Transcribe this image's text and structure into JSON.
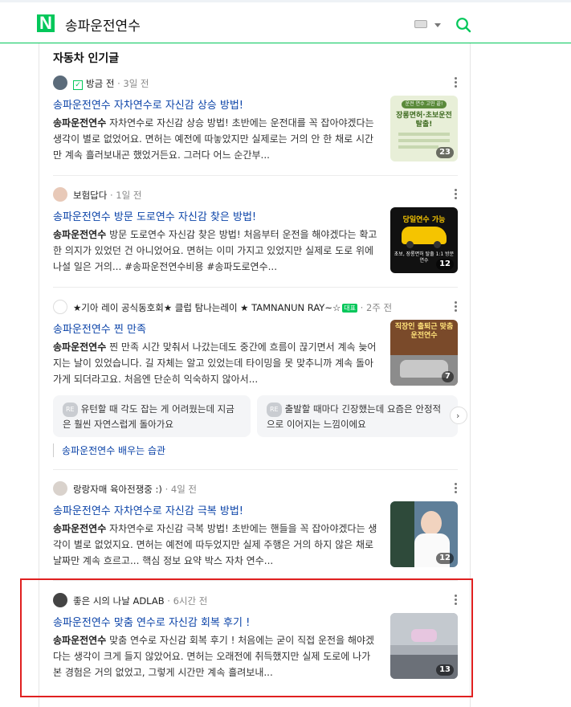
{
  "header": {
    "title": "송파운전연수",
    "logo_letter": "N"
  },
  "section": {
    "title": "자동차 인기글"
  },
  "posts": [
    {
      "author": "방금 전",
      "time": "· 3일 전",
      "title": "송파운전연수 자차연수로 자신감 상승 방법!",
      "body_bold": "송파운전연수",
      "body": " 자차연수로 자신감 상승 방법! 초반에는 운전대를 꼭 잡아야겠다는 생각이 별로 없었어요. 면허는 예전에 따놓았지만 실제로는 거의 안 한 채로 시간만 계속 흘러보내곤 했었거든요. 그러다 어느 순간부...",
      "thumb_count": "23"
    },
    {
      "author": "보험답다",
      "time": "· 1일 전",
      "title": "송파운전연수 방문 도로연수 자신감 찾은 방법!",
      "body_bold": "송파운전연수",
      "body": " 방문 도로연수 자신감 찾은 방법! 처음부터 운전을 해야겠다는 확고한 의지가 있었던 건 아니었어요. 면허는 이미 가지고 있었지만 실제로 도로 위에 나설 일은 거의... #송파운전연수비용 #송파도로연수...",
      "thumb_count": "12"
    },
    {
      "author": "★기아 레이 공식동호회★ 클럽 탐나는레이 ★ TAMNANUN RAY~☆",
      "badge": "대표",
      "time": "· 2주 전",
      "title": "송파운전연수 찐 만족",
      "body_bold": "송파운전연수",
      "body": " 찐 만족 시간 맞춰서 나갔는데도 중간에 흐름이 끊기면서 계속 늦어지는 날이 있었습니다. 길 자체는 알고 있었는데 타이밍을 못 맞추니까 계속 돌아가게 되더라고요. 처음엔 단순히 익숙하지 않아서...",
      "thumb_count": "7",
      "replies": [
        "유턴할 때 각도 잡는 게 어려웠는데 지금은 훨씬 자연스럽게 돌아가요",
        "출발할 때마다 긴장했는데 요즘은 안정적으로 이어지는 느낌이에요"
      ],
      "re_label": "RE",
      "tag": "송파운전연수 배우는 습관"
    },
    {
      "author": "랑랑자매 육아전쟁중 :)",
      "time": "· 4일 전",
      "title": "송파운전연수 자차연수로 자신감 극복 방법!",
      "body_bold": "송파운전연수",
      "body": " 자차연수로 자신감 극복 방법! 초반에는 핸들을 꼭 잡아야겠다는 생각이 별로 없었지요. 면허는 예전에 따두었지만 실제 주행은 거의 하지 않은 채로 날짜만 계속 흐르고... 핵심 정보 요약 박스 자차 연수...",
      "thumb_count": "12"
    },
    {
      "author": "좋은 시의 나날 ADLAB",
      "time": "· 6시간 전",
      "title": "송파운전연수 맞춤 연수로 자신감 회복 후기 !",
      "body_bold": "송파운전연수",
      "body": " 맞춤 연수로 자신감 회복 후기 ! 처음에는 굳이 직접 운전을 해야겠다는 생각이 크게 들지 않았어요. 면허는 오래전에 취득했지만 실제 도로에 나가본 경험은 거의 없었고, 그렇게 시간만 계속 흘려보내...",
      "thumb_count": "13"
    }
  ],
  "thumb_texts": {
    "t1_top": "운전 연수 고민 끝!",
    "t1_main": "장롱면허·초보운전 탈출!",
    "t2_main": "당일연수 가능",
    "t2_sub": "초보, 장롱면허 탈출 1:1 방문연수",
    "t3_main": "직장인 출퇴근 맞춤 운전연수"
  },
  "colors": {
    "accent": "#03c75a",
    "link": "#0b43a8",
    "highlight": "#e02020"
  }
}
